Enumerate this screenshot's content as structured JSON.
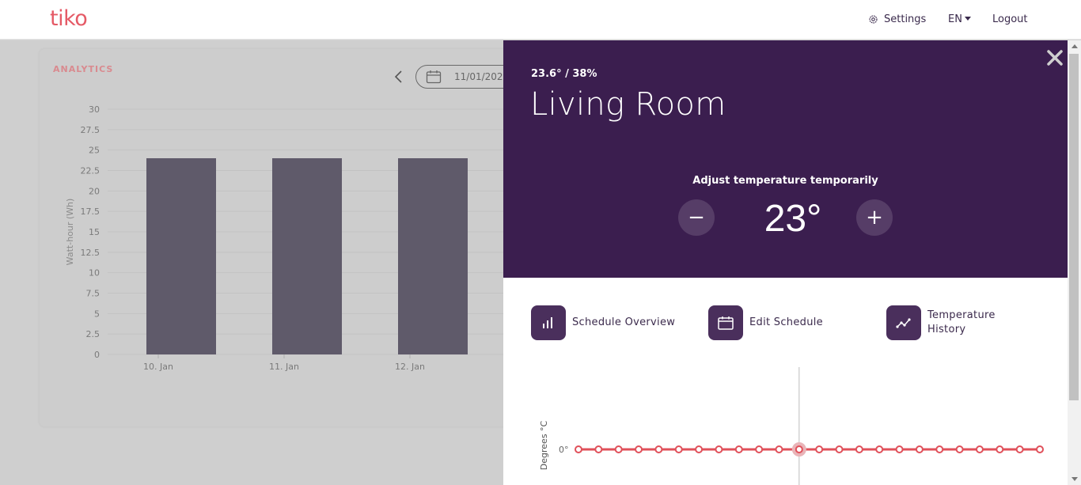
{
  "nav": {
    "logo": "tiko",
    "settings_label": "Settings",
    "language_label": "EN",
    "logout_label": "Logout"
  },
  "analytics": {
    "title": "ANALYTICS",
    "date_value": "11/01/202",
    "chart_data": {
      "type": "bar",
      "categories": [
        "10. Jan",
        "11. Jan",
        "12. Jan"
      ],
      "values": [
        24,
        24,
        24
      ],
      "ylabel": "Watt-hour (Wh)",
      "ylim": [
        0,
        30
      ],
      "yticks": [
        "0",
        "2.5",
        "5",
        "7.5",
        "10",
        "12.5",
        "15",
        "17.5",
        "20",
        "22.5",
        "25",
        "27.5",
        "30"
      ],
      "grid": true,
      "bar_color": "#5f5a6a"
    }
  },
  "room": {
    "reading": "23.6° / 38%",
    "name": "Living Room",
    "adjust_label": "Adjust temperature temporarily",
    "temperature": "23°",
    "minus_symbol": "−",
    "plus_symbol": "+"
  },
  "tabs": [
    {
      "label": "Schedule Overview",
      "icon": "bar-chart-icon"
    },
    {
      "label": "Edit Schedule",
      "icon": "calendar-icon"
    },
    {
      "label": "Temperature History",
      "icon": "trend-line-icon"
    }
  ],
  "history": {
    "ylabel": "Degrees °C",
    "ytick": "0°",
    "point_count": 24,
    "values": [
      0,
      0,
      0,
      0,
      0,
      0,
      0,
      0,
      0,
      0,
      0,
      0,
      0,
      0,
      0,
      0,
      0,
      0,
      0,
      0,
      0,
      0,
      0,
      0
    ],
    "highlight_index": 11,
    "line_color": "#e0505a"
  },
  "colors": {
    "brand": "#e55a66",
    "header_purple": "#3b1e4f",
    "button_purple": "#563d67"
  }
}
